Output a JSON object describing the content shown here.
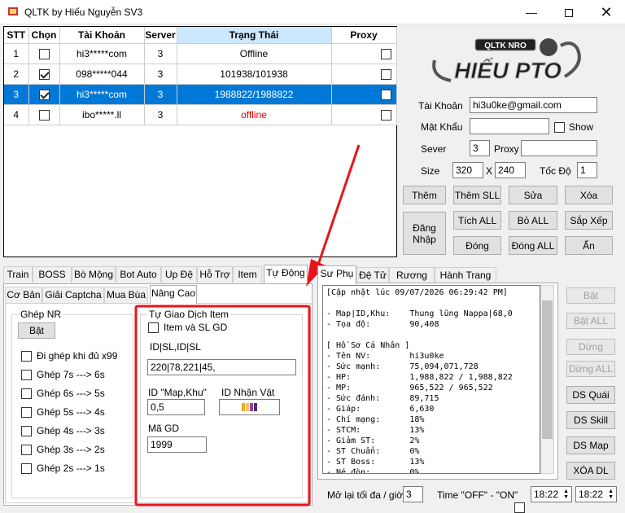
{
  "window": {
    "title": "QLTK by Hiếu Nguyễn SV3"
  },
  "grid": {
    "headers": [
      "STT",
      "Chọn",
      "Tài Khoản",
      "Server",
      "Trạng Thái",
      "Proxy"
    ],
    "rows": [
      {
        "stt": "1",
        "checked": false,
        "account": "hi3*****com",
        "server": "3",
        "status": "Offline",
        "status_color": "#000000"
      },
      {
        "stt": "2",
        "checked": true,
        "account": "098*****044",
        "server": "3",
        "status": "101938/101938",
        "status_color": "#000000"
      },
      {
        "stt": "3",
        "checked": true,
        "account": "hi3*****com",
        "server": "3",
        "status": "1988822/1988822",
        "status_color": "#000000"
      },
      {
        "stt": "4",
        "checked": false,
        "account": "ibo*****.ll",
        "server": "3",
        "status": "offline",
        "status_color": "#e00000"
      }
    ]
  },
  "logo": {
    "top_text": "QLTK NRO",
    "main_text": "HIẾU PTO"
  },
  "form": {
    "account_label": "Tài Khoản",
    "account_value": "hi3u0ke@gmail.com",
    "password_label": "Mật Khẩu",
    "password_value": "",
    "show_label": "Show",
    "server_label": "Sever",
    "server_value": "3",
    "proxy_label": "Proxy",
    "proxy_value": "",
    "size_label": "Size",
    "size_w": "320",
    "size_x": "X",
    "size_h": "240",
    "speed_label": "Tốc Độ",
    "speed_value": "1"
  },
  "buttons": {
    "add": "Thêm",
    "add_sll": "Thêm SLL",
    "edit": "Sửa",
    "delete": "Xóa",
    "login": "Đăng Nhập",
    "tick_all": "Tích ALL",
    "untick_all": "Bỏ  ALL",
    "sort": "Sắp Xếp",
    "close": "Đóng",
    "close_all": "Đóng ALL",
    "hide": "Ẩn"
  },
  "left_tabs": [
    "Train",
    "BOSS",
    "Bò Mộng",
    "Bot Auto",
    "Up Đệ",
    "Hỗ Trợ",
    "Item",
    "Tự Động"
  ],
  "sub_tabs": [
    "Cơ Bản",
    "Giải Captcha",
    "Mua Bùa",
    "Nâng Cao"
  ],
  "ghep": {
    "title": "Ghép NR",
    "toggle": "Bật",
    "options": [
      "Đi ghép khi đủ x99",
      "Ghép 7s ---> 6s",
      "Ghép 6s ---> 5s",
      "Ghép 5s ---> 4s",
      "Ghép 4s ---> 3s",
      "Ghép 3s ---> 2s",
      "Ghép 2s ---> 1s"
    ]
  },
  "trade": {
    "title": "Tự Giao Dịch Item",
    "item_checkbox": "Item và SL GD",
    "format_label": "ID|SL,ID|SL",
    "items_value": "220|78,221|45,",
    "map_label": "ID \"Map,Khu\"",
    "map_value": "0,5",
    "receiver_label": "ID Nhận Vật",
    "code_label": "Mã GD",
    "code_value": "1999"
  },
  "right_tabs": [
    "Sư Phụ",
    "Đệ Tử",
    "Rương Đồ",
    "Hành Trang"
  ],
  "console_lines": [
    "[Cập nhật lúc 09/07/2026 06:29:42 PM]",
    "",
    "- Map|ID,Khu:    Thung lũng Nappa|68,0",
    "- Tọa độ:        90,408",
    "",
    "[ Hồ Sơ Cá Nhân ]",
    "- Tên NV:        hi3u0ke",
    "- Sức mạnh:      75,094,071,728",
    "- HP:            1,988,822 / 1,988,822",
    "- MP:            965,522 / 965,522",
    "- Sức đánh:      89,715",
    "- Giáp:          6,630",
    "- Chí mạng:      18%",
    "- STCM:          13%",
    "- Giảm ST:       2%",
    "- ST Chuẩn:      0%",
    "- ST Boss:       13%",
    "- Né đòn:        0%"
  ],
  "side_buttons": {
    "on": "Bật",
    "on_all": "Bật ALL",
    "stop": "Dừng",
    "stop_all": "Dừng ALL",
    "ds_quai": "DS Quái",
    "ds_skill": "DS Skill",
    "ds_map": "DS Map",
    "clear_log": "XÓA DL"
  },
  "bottom": {
    "reload_label": "Mở lại tối đa / giờ",
    "reload_value": "3",
    "time_label": "Time \"OFF\" - \"ON\"",
    "time_off": "18:22",
    "time_on": "18:22"
  },
  "colors": {
    "selection": "#0078d7",
    "annotation": "#e8141b"
  }
}
